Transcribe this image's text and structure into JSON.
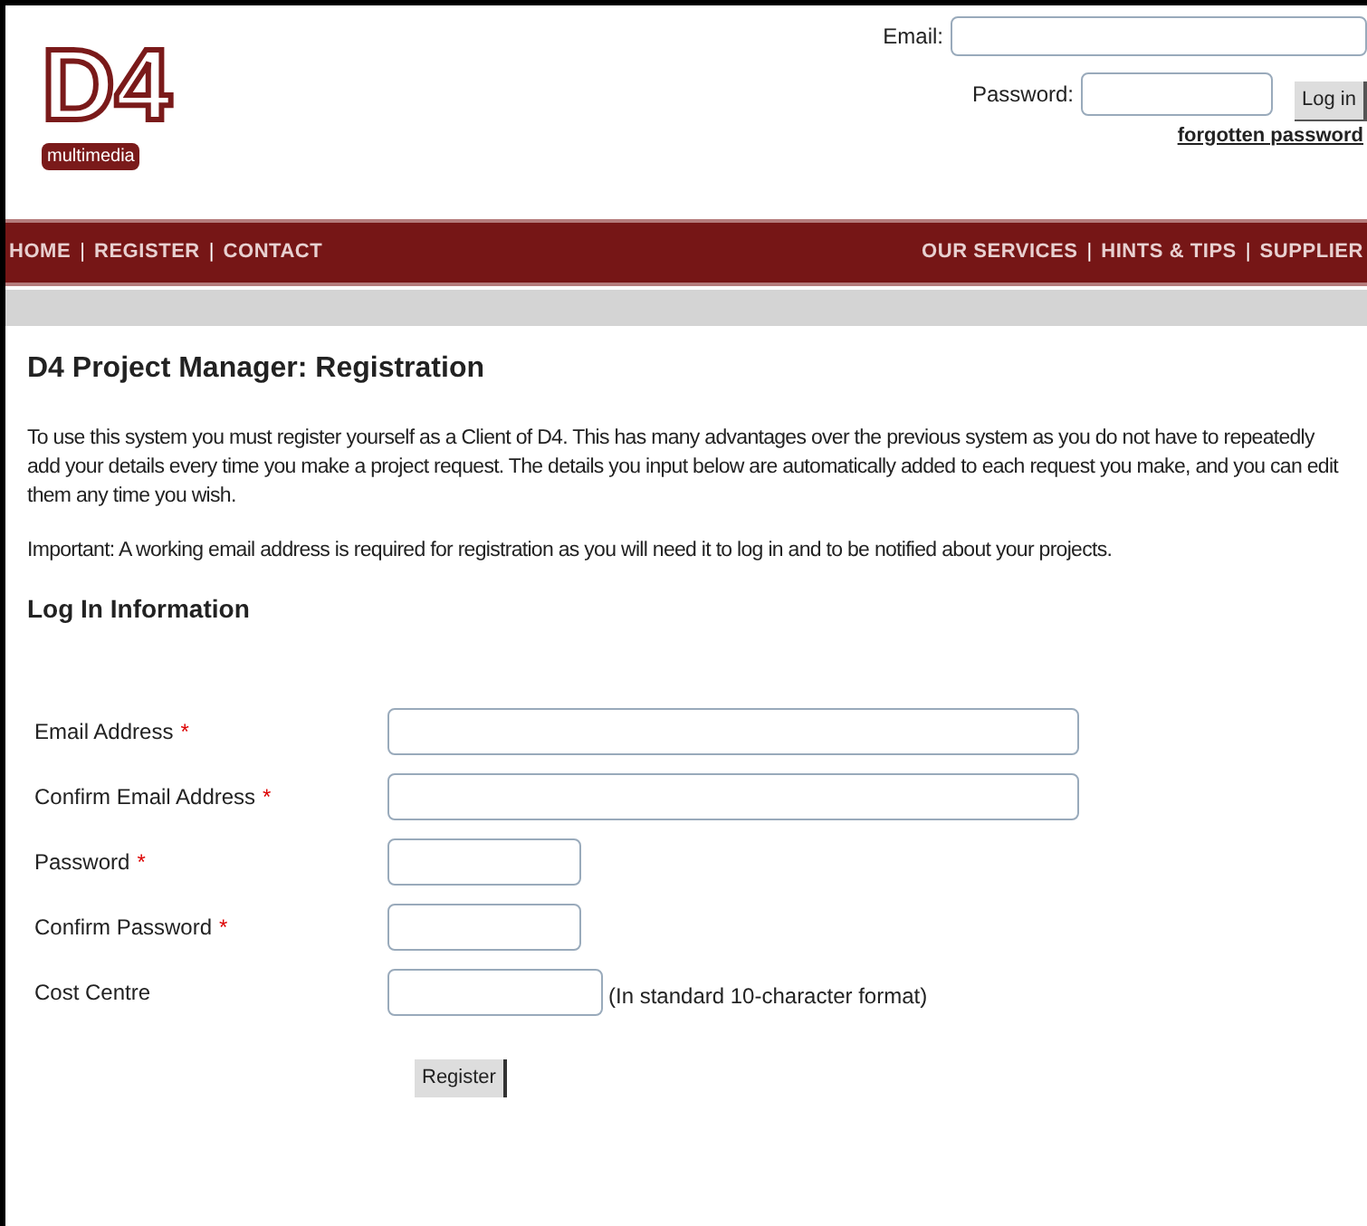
{
  "logo": {
    "mark": "D4",
    "tagline": "multimedia"
  },
  "login": {
    "email_label": "Email:",
    "password_label": "Password:",
    "button": "Log in",
    "forgot_link": "forgotten password"
  },
  "nav_separator": "|",
  "nav_left": [
    "HOME",
    "REGISTER",
    "CONTACT"
  ],
  "nav_right": [
    "OUR SERVICES",
    "HINTS & TIPS",
    "SUPPLIER"
  ],
  "title": "D4 Project Manager: Registration",
  "paragraphs": [
    "To use this system you must register yourself as a Client of D4. This has many advantages over the previous system as you do not have to repeatedly add your details every time you make a project request. The details you input below are automatically added to each request you make, and you can edit them any time you wish.",
    "Important: A working email address is required for registration as you will need it to log in and to be notified about your projects."
  ],
  "section_title": "Log In Information",
  "fields": [
    {
      "label": "Email Address",
      "required": true,
      "kind": "long"
    },
    {
      "label": "Confirm Email Address",
      "required": true,
      "kind": "long"
    },
    {
      "label": "Password",
      "required": true,
      "kind": "short"
    },
    {
      "label": "Confirm Password",
      "required": true,
      "kind": "short"
    },
    {
      "label": "Cost Centre",
      "required": false,
      "kind": "medium",
      "hint": "(In standard 10-character format)"
    }
  ],
  "required_mark": "*",
  "register_button": "Register"
}
